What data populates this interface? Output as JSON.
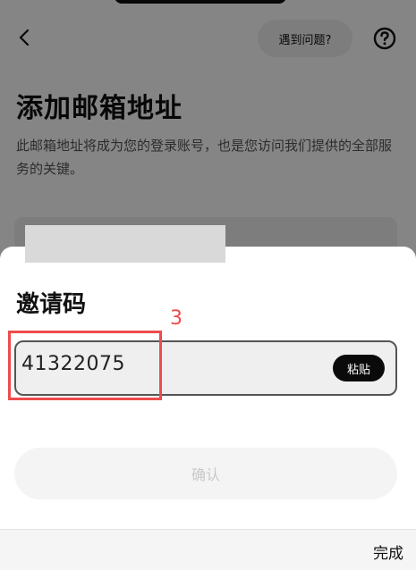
{
  "background": {
    "help_label": "遇到问题?",
    "title": "添加邮箱地址",
    "description": "此邮箱地址将成为您的登录账号，也是您访问我们提供的全部服务的关键。"
  },
  "sheet": {
    "title": "邀请码",
    "code_value": "41322075",
    "paste_label": "粘贴",
    "confirm_label": "确认"
  },
  "annotation": {
    "number": "3",
    "color": "#ef4b4b"
  },
  "keyboard_bar": {
    "done_label": "完成"
  }
}
